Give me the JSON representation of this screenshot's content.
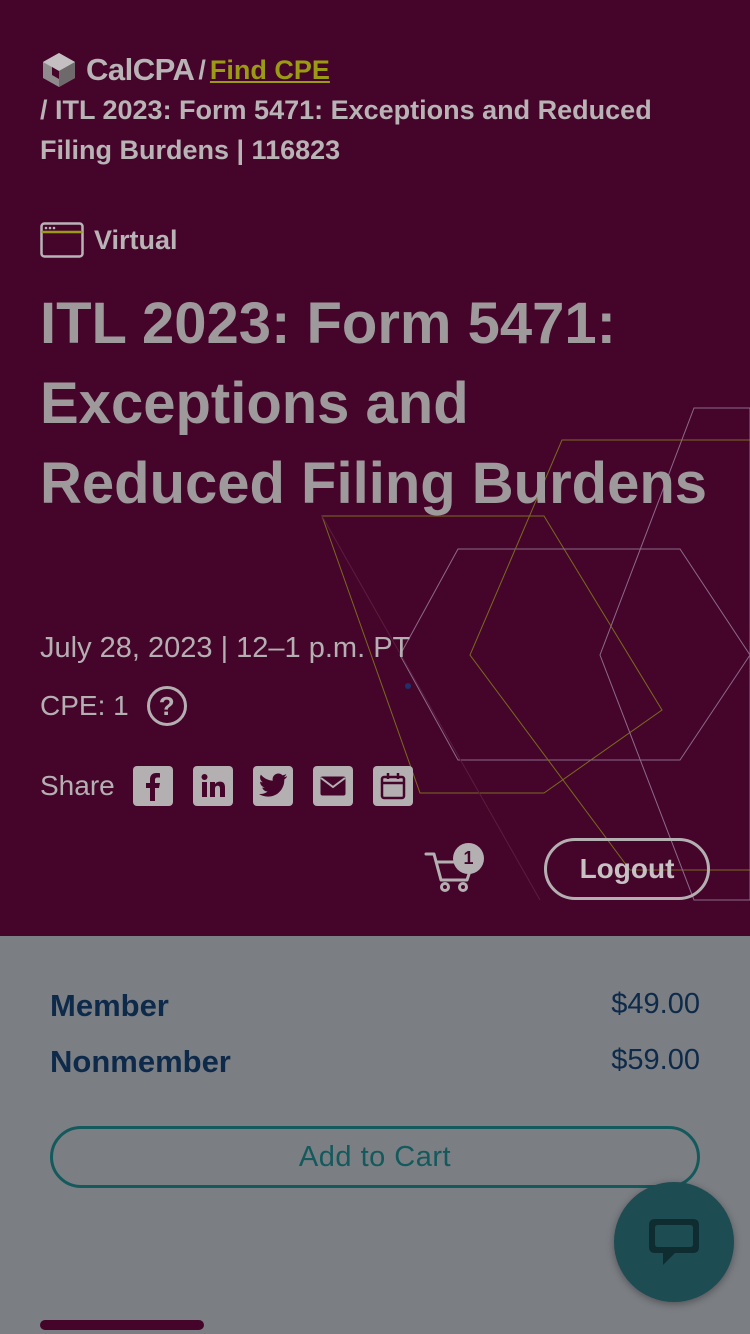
{
  "breadcrumb": {
    "logo_text": "CalCPA",
    "separator": "/",
    "link_label": "Find CPE",
    "current": "/ ITL 2023: Form 5471: Exceptions and Reduced Filing Burdens | 116823"
  },
  "event": {
    "format": "Virtual",
    "title": "ITL 2023: Form 5471: Exceptions and Reduced Filing Burdens",
    "date_time": "July 28, 2023 | 12–1 p.m. PT",
    "cpe_label": "CPE: 1",
    "help_symbol": "?"
  },
  "share": {
    "label": "Share",
    "icons": [
      "facebook-icon",
      "linkedin-icon",
      "twitter-icon",
      "email-icon",
      "calendar-icon"
    ]
  },
  "header_actions": {
    "cart_count": "1",
    "logout_label": "Logout"
  },
  "pricing": {
    "member_label": "Member",
    "member_price": "$49.00",
    "nonmember_label": "Nonmember",
    "nonmember_price": "$59.00",
    "add_to_cart_label": "Add to Cart"
  },
  "colors": {
    "hero_bg": "#45052a",
    "link_accent": "#9a9a14",
    "price_text": "#0e2a4a",
    "teal": "#145a5d",
    "chat_bg": "#1d4c52"
  }
}
